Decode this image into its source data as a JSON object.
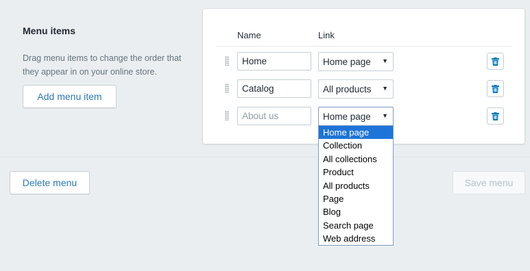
{
  "section": {
    "title": "Menu items",
    "description": "Drag menu items to change the order that they appear in on your online store.",
    "add_button": "Add menu item"
  },
  "table": {
    "headers": {
      "name": "Name",
      "link": "Link"
    },
    "rows": [
      {
        "name": "Home",
        "link": "Home page"
      },
      {
        "name": "Catalog",
        "link": "All products"
      },
      {
        "name": "",
        "placeholder": "About us",
        "link": "Home page"
      }
    ]
  },
  "dropdown": {
    "selected": "Home page",
    "options": [
      "Home page",
      "Collection",
      "All collections",
      "Product",
      "All products",
      "Page",
      "Blog",
      "Search page",
      "Web address"
    ]
  },
  "footer": {
    "delete_button": "Delete menu",
    "save_button": "Save menu"
  },
  "icons": {
    "drag": "drag-handle-icon",
    "delete": "trash-icon",
    "caret": "caret-down-icon"
  },
  "colors": {
    "accent": "#2a7ab8",
    "selection": "#1e74d8",
    "trash": "#0078bd"
  }
}
